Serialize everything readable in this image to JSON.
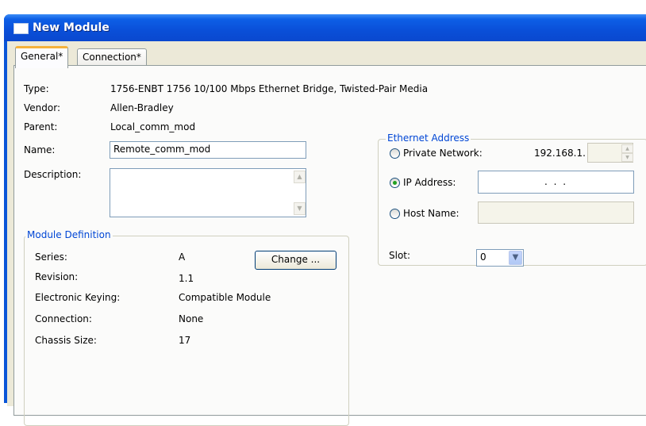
{
  "window": {
    "title": "New Module"
  },
  "tabs": [
    {
      "label": "General*",
      "active": true
    },
    {
      "label": "Connection*",
      "active": false
    }
  ],
  "general": {
    "type_label": "Type:",
    "type_value": "1756-ENBT 1756 10/100 Mbps Ethernet Bridge, Twisted-Pair Media",
    "vendor_label": "Vendor:",
    "vendor_value": "Allen-Bradley",
    "parent_label": "Parent:",
    "parent_value": "Local_comm_mod",
    "name_label": "Name:",
    "name_value": "Remote_comm_mod",
    "description_label": "Description:",
    "description_value": ""
  },
  "module_definition": {
    "title": "Module Definition",
    "series_label": "Series:",
    "series_value": "A",
    "revision_label": "Revision:",
    "revision_value": "1.1",
    "keying_label": "Electronic Keying:",
    "keying_value": "Compatible Module",
    "connection_label": "Connection:",
    "connection_value": "None",
    "chassis_label": "Chassis Size:",
    "chassis_value": "17",
    "change_button": "Change ..."
  },
  "ethernet": {
    "title": "Ethernet Address",
    "private_label": "Private Network:",
    "private_prefix": "192.168.1.",
    "ip_label": "IP Address:",
    "ip_value": ".       .       .",
    "host_label": "Host Name:",
    "selected": "ip"
  },
  "slot": {
    "label": "Slot:",
    "value": "0"
  },
  "colors": {
    "title_bar": "#0a4fd8",
    "group_title": "#0046d5",
    "panel": "#ece9d8"
  }
}
